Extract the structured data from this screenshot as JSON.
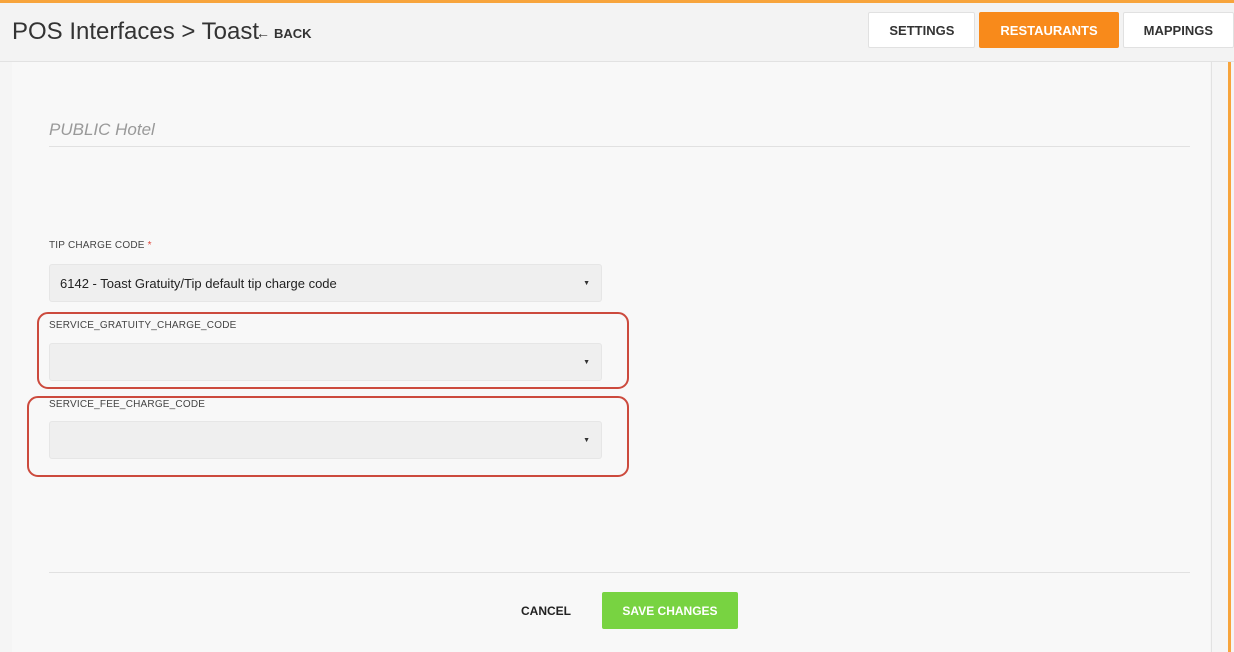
{
  "header": {
    "title": "POS Interfaces > Toast",
    "back_label": "BACK",
    "tabs": [
      {
        "label": "SETTINGS",
        "active": false
      },
      {
        "label": "RESTAURANTS",
        "active": true
      },
      {
        "label": "MAPPINGS",
        "active": false
      }
    ]
  },
  "form": {
    "hotel_name": "PUBLIC Hotel",
    "fields": [
      {
        "label": "TIP CHARGE CODE",
        "required_marker": "*",
        "value": "6142 - Toast Gratuity/Tip default tip charge code"
      },
      {
        "label": "SERVICE_GRATUITY_CHARGE_CODE",
        "value": ""
      },
      {
        "label": "SERVICE_FEE_CHARGE_CODE",
        "value": ""
      }
    ]
  },
  "actions": {
    "cancel_label": "CANCEL",
    "save_label": "SAVE CHANGES"
  },
  "colors": {
    "accent": "#f88a1b",
    "save": "#78d341",
    "highlight": "#cc4a3d"
  },
  "icons": {
    "back": "arrow-left-icon",
    "dropdown": "caret-down-icon"
  }
}
